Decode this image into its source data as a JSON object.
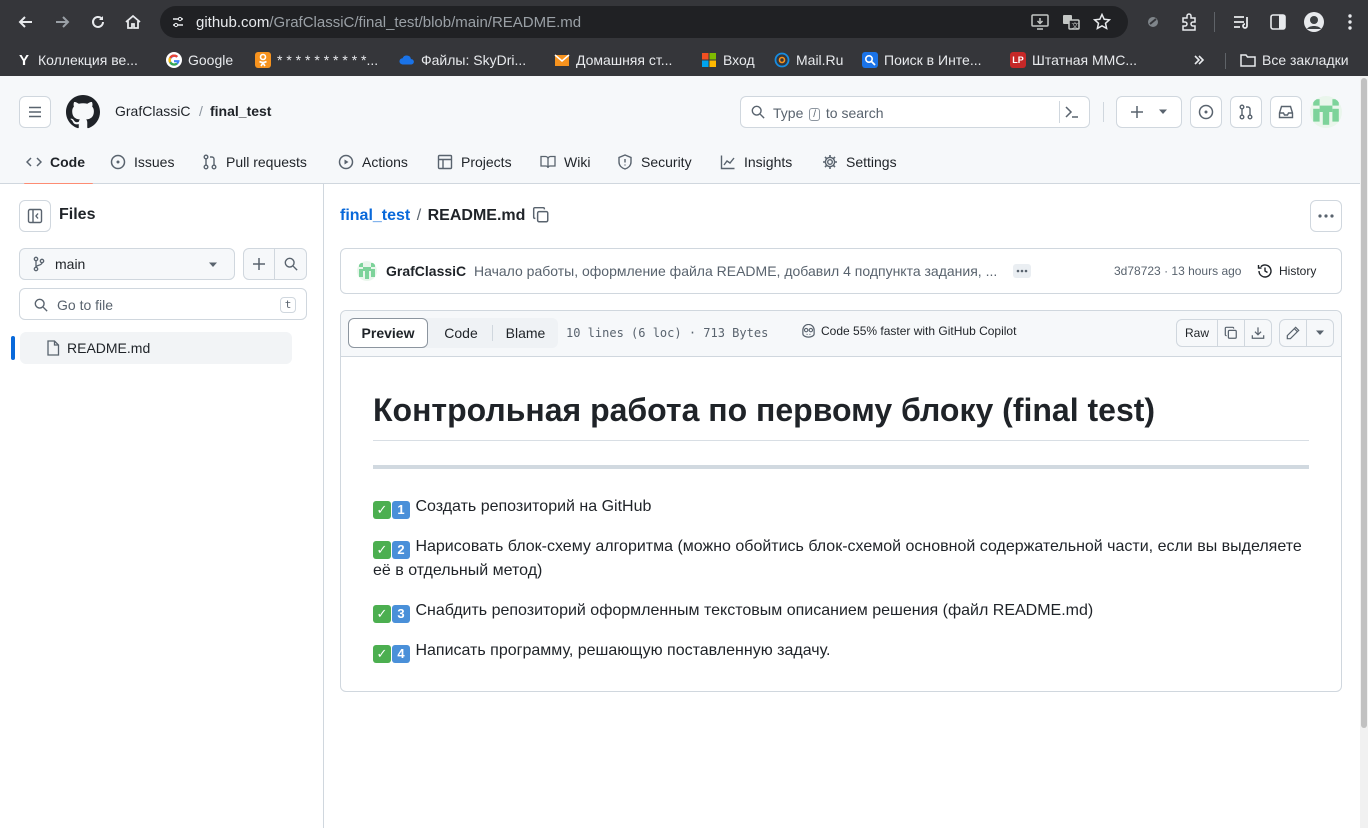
{
  "browser": {
    "url_host": "github.com",
    "url_path": "/GrafClassiC/final_test/blob/main/README.md",
    "bookmarks": [
      {
        "label": "Коллекция ве...",
        "icon": "yandex-icon",
        "color": "#35363a"
      },
      {
        "label": "Google",
        "icon": "google-icon",
        "color": "#ffffff"
      },
      {
        "label": "* * * * * * * * * *...",
        "icon": "odnoklassniki-icon",
        "color": "#f7931e"
      },
      {
        "label": "Файлы: SkyDri...",
        "icon": "cloud-icon",
        "color": "#1a73e8"
      },
      {
        "label": "Домашняя ст...",
        "icon": "home-mail-icon",
        "color": "#f7931e"
      },
      {
        "label": "Вход",
        "icon": "windows-icon",
        "color": "#00a4ef"
      },
      {
        "label": "Mail.Ru",
        "icon": "mailru-icon",
        "color": "#168de2"
      },
      {
        "label": "Поиск в Инте...",
        "icon": "search-engine-icon",
        "color": "#1a73e8"
      },
      {
        "label": "Штатная ММС...",
        "icon": "lp-icon",
        "color": "#c62828"
      }
    ],
    "all_bookmarks": "Все закладки",
    "lp_text": "LP"
  },
  "github": {
    "owner": "GrafClassiC",
    "separator": "/",
    "repo": "final_test",
    "search_before": "Type",
    "search_key": "/",
    "search_after": "to search",
    "tabs": [
      {
        "label": "Code",
        "icon": "code-icon"
      },
      {
        "label": "Issues",
        "icon": "issue-icon"
      },
      {
        "label": "Pull requests",
        "icon": "pull-request-icon"
      },
      {
        "label": "Actions",
        "icon": "play-icon"
      },
      {
        "label": "Projects",
        "icon": "table-icon"
      },
      {
        "label": "Wiki",
        "icon": "book-icon"
      },
      {
        "label": "Security",
        "icon": "shield-icon"
      },
      {
        "label": "Insights",
        "icon": "graph-icon"
      },
      {
        "label": "Settings",
        "icon": "gear-icon"
      }
    ]
  },
  "sidebar": {
    "title": "Files",
    "branch": "main",
    "go_to_file": "Go to file",
    "go_to_file_key": "t",
    "files": [
      "README.md"
    ]
  },
  "main": {
    "path_repo": "final_test",
    "path_sep": "/",
    "path_file": "README.md",
    "commit": {
      "author": "GrafClassiC",
      "message": "Начало работы, оформление файла README, добавил 4 подпункта задания, ...",
      "sha": "3d78723",
      "time_sep": "·",
      "time": "13 hours ago",
      "history": "History"
    },
    "toolbar": {
      "preview": "Preview",
      "code": "Code",
      "blame": "Blame",
      "stats": "10 lines (6 loc) · 713 Bytes",
      "copilot": "Code 55% faster with GitHub Copilot",
      "raw": "Raw"
    },
    "readme": {
      "title": "Контрольная работа по первому блоку (final test)",
      "check_glyph": "✓",
      "items": [
        {
          "num": "1",
          "text": "Создать репозиторий на GitHub"
        },
        {
          "num": "2",
          "text": "Нарисовать блок-схему алгоритма (можно обойтись блок-схемой основной содержательной части, если вы выделяете её в отдельный метод)"
        },
        {
          "num": "3",
          "text": "Снабдить репозиторий оформленным текстовым описанием решения (файл README.md)"
        },
        {
          "num": "4",
          "text": "Написать программу, решающую поставленную задачу."
        }
      ]
    }
  },
  "colors": {
    "chrome": "#35363a",
    "accent": "#0969da",
    "tab_underline": "#fd8c73",
    "check": "#4caf50",
    "number": "#4a90d9"
  }
}
